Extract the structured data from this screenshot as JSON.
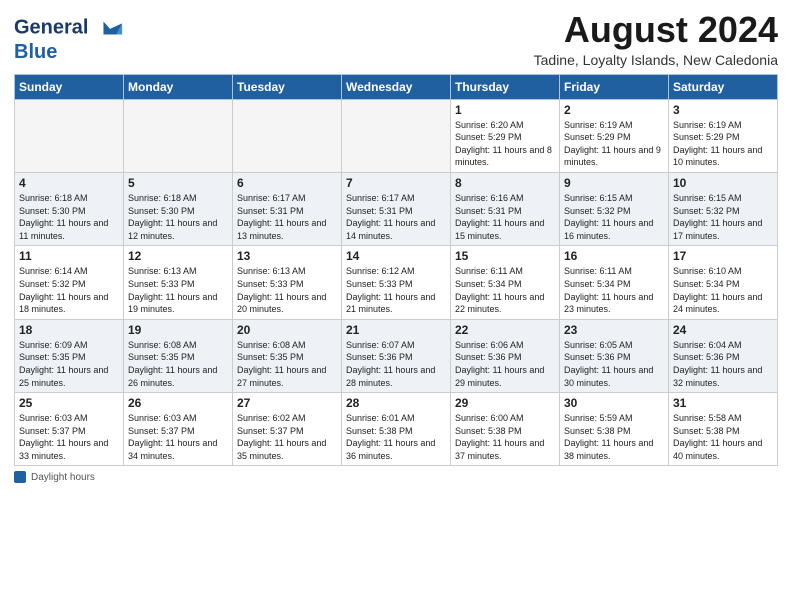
{
  "header": {
    "logo_line1": "General",
    "logo_line2": "Blue",
    "month_title": "August 2024",
    "subtitle": "Tadine, Loyalty Islands, New Caledonia"
  },
  "weekdays": [
    "Sunday",
    "Monday",
    "Tuesday",
    "Wednesday",
    "Thursday",
    "Friday",
    "Saturday"
  ],
  "weeks": [
    [
      {
        "day": "",
        "info": ""
      },
      {
        "day": "",
        "info": ""
      },
      {
        "day": "",
        "info": ""
      },
      {
        "day": "",
        "info": ""
      },
      {
        "day": "1",
        "info": "Sunrise: 6:20 AM\nSunset: 5:29 PM\nDaylight: 11 hours and 8 minutes."
      },
      {
        "day": "2",
        "info": "Sunrise: 6:19 AM\nSunset: 5:29 PM\nDaylight: 11 hours and 9 minutes."
      },
      {
        "day": "3",
        "info": "Sunrise: 6:19 AM\nSunset: 5:29 PM\nDaylight: 11 hours and 10 minutes."
      }
    ],
    [
      {
        "day": "4",
        "info": "Sunrise: 6:18 AM\nSunset: 5:30 PM\nDaylight: 11 hours and 11 minutes."
      },
      {
        "day": "5",
        "info": "Sunrise: 6:18 AM\nSunset: 5:30 PM\nDaylight: 11 hours and 12 minutes."
      },
      {
        "day": "6",
        "info": "Sunrise: 6:17 AM\nSunset: 5:31 PM\nDaylight: 11 hours and 13 minutes."
      },
      {
        "day": "7",
        "info": "Sunrise: 6:17 AM\nSunset: 5:31 PM\nDaylight: 11 hours and 14 minutes."
      },
      {
        "day": "8",
        "info": "Sunrise: 6:16 AM\nSunset: 5:31 PM\nDaylight: 11 hours and 15 minutes."
      },
      {
        "day": "9",
        "info": "Sunrise: 6:15 AM\nSunset: 5:32 PM\nDaylight: 11 hours and 16 minutes."
      },
      {
        "day": "10",
        "info": "Sunrise: 6:15 AM\nSunset: 5:32 PM\nDaylight: 11 hours and 17 minutes."
      }
    ],
    [
      {
        "day": "11",
        "info": "Sunrise: 6:14 AM\nSunset: 5:32 PM\nDaylight: 11 hours and 18 minutes."
      },
      {
        "day": "12",
        "info": "Sunrise: 6:13 AM\nSunset: 5:33 PM\nDaylight: 11 hours and 19 minutes."
      },
      {
        "day": "13",
        "info": "Sunrise: 6:13 AM\nSunset: 5:33 PM\nDaylight: 11 hours and 20 minutes."
      },
      {
        "day": "14",
        "info": "Sunrise: 6:12 AM\nSunset: 5:33 PM\nDaylight: 11 hours and 21 minutes."
      },
      {
        "day": "15",
        "info": "Sunrise: 6:11 AM\nSunset: 5:34 PM\nDaylight: 11 hours and 22 minutes."
      },
      {
        "day": "16",
        "info": "Sunrise: 6:11 AM\nSunset: 5:34 PM\nDaylight: 11 hours and 23 minutes."
      },
      {
        "day": "17",
        "info": "Sunrise: 6:10 AM\nSunset: 5:34 PM\nDaylight: 11 hours and 24 minutes."
      }
    ],
    [
      {
        "day": "18",
        "info": "Sunrise: 6:09 AM\nSunset: 5:35 PM\nDaylight: 11 hours and 25 minutes."
      },
      {
        "day": "19",
        "info": "Sunrise: 6:08 AM\nSunset: 5:35 PM\nDaylight: 11 hours and 26 minutes."
      },
      {
        "day": "20",
        "info": "Sunrise: 6:08 AM\nSunset: 5:35 PM\nDaylight: 11 hours and 27 minutes."
      },
      {
        "day": "21",
        "info": "Sunrise: 6:07 AM\nSunset: 5:36 PM\nDaylight: 11 hours and 28 minutes."
      },
      {
        "day": "22",
        "info": "Sunrise: 6:06 AM\nSunset: 5:36 PM\nDaylight: 11 hours and 29 minutes."
      },
      {
        "day": "23",
        "info": "Sunrise: 6:05 AM\nSunset: 5:36 PM\nDaylight: 11 hours and 30 minutes."
      },
      {
        "day": "24",
        "info": "Sunrise: 6:04 AM\nSunset: 5:36 PM\nDaylight: 11 hours and 32 minutes."
      }
    ],
    [
      {
        "day": "25",
        "info": "Sunrise: 6:03 AM\nSunset: 5:37 PM\nDaylight: 11 hours and 33 minutes."
      },
      {
        "day": "26",
        "info": "Sunrise: 6:03 AM\nSunset: 5:37 PM\nDaylight: 11 hours and 34 minutes."
      },
      {
        "day": "27",
        "info": "Sunrise: 6:02 AM\nSunset: 5:37 PM\nDaylight: 11 hours and 35 minutes."
      },
      {
        "day": "28",
        "info": "Sunrise: 6:01 AM\nSunset: 5:38 PM\nDaylight: 11 hours and 36 minutes."
      },
      {
        "day": "29",
        "info": "Sunrise: 6:00 AM\nSunset: 5:38 PM\nDaylight: 11 hours and 37 minutes."
      },
      {
        "day": "30",
        "info": "Sunrise: 5:59 AM\nSunset: 5:38 PM\nDaylight: 11 hours and 38 minutes."
      },
      {
        "day": "31",
        "info": "Sunrise: 5:58 AM\nSunset: 5:38 PM\nDaylight: 11 hours and 40 minutes."
      }
    ]
  ],
  "footer": {
    "label": "Daylight hours"
  }
}
